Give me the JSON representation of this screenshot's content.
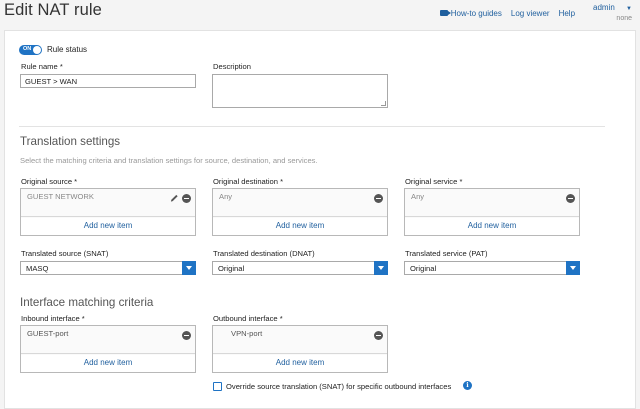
{
  "page": {
    "title": "Edit NAT rule"
  },
  "top_links": {
    "how_to": "How-to guides",
    "log_viewer": "Log viewer",
    "help": "Help",
    "admin": "admin",
    "admin_sub": "none"
  },
  "rule_status": {
    "toggle_text": "ON",
    "label": "Rule status",
    "on": true
  },
  "rule_name": {
    "label": "Rule name *",
    "value": "GUEST > WAN"
  },
  "description": {
    "label": "Description",
    "value": ""
  },
  "translation": {
    "title": "Translation settings",
    "desc": "Select the matching criteria and translation settings for source, destination, and services.",
    "original_source": {
      "label": "Original source *",
      "item": "GUEST NETWORK",
      "add": "Add new item"
    },
    "original_destination": {
      "label": "Original destination *",
      "item": "Any",
      "add": "Add new item"
    },
    "original_service": {
      "label": "Original service *",
      "item": "Any",
      "add": "Add new item"
    },
    "translated_source": {
      "label": "Translated source (SNAT)",
      "value": "MASQ"
    },
    "translated_destination": {
      "label": "Translated destination (DNAT)",
      "value": "Original"
    },
    "translated_service": {
      "label": "Translated service (PAT)",
      "value": "Original"
    }
  },
  "interface": {
    "title": "Interface matching criteria",
    "inbound": {
      "label": "Inbound interface *",
      "item": "GUEST-port",
      "add": "Add new item"
    },
    "outbound": {
      "label": "Outbound interface *",
      "item": "VPN-port",
      "add": "Add new item"
    },
    "override_label": "Override source translation (SNAT) for specific outbound interfaces",
    "override_checked": false
  },
  "colors": {
    "accent": "#1f73c4",
    "link": "#1f5f9e"
  },
  "icons": {
    "video": "video-icon",
    "remove": "minus-circle-icon",
    "edit": "pencil-icon",
    "info": "info-icon"
  }
}
